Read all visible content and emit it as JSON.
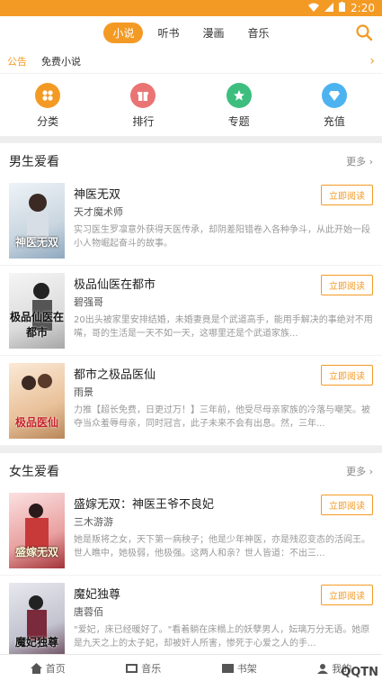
{
  "status": {
    "time": "2:20"
  },
  "tabs": [
    {
      "label": "小说",
      "active": true
    },
    {
      "label": "听书",
      "active": false
    },
    {
      "label": "漫画",
      "active": false
    },
    {
      "label": "音乐",
      "active": false
    }
  ],
  "notice": {
    "tag": "公告",
    "text": "免费小说",
    "arrow": "›"
  },
  "quicknav": [
    {
      "label": "分类",
      "color": "#F39A25",
      "icon": "grid-icon"
    },
    {
      "label": "排行",
      "color": "#EA7474",
      "icon": "gift-icon"
    },
    {
      "label": "专题",
      "color": "#3DBE7E",
      "icon": "star-icon"
    },
    {
      "label": "充值",
      "color": "#4CB3F0",
      "icon": "diamond-icon"
    }
  ],
  "male_section": {
    "title": "男生爱看",
    "more": "更多 ›",
    "books": [
      {
        "title": "神医无双",
        "author": "天才魔术师",
        "desc": "实习医生罗凛意外获得天医传承，却阴差阳错卷入各种争斗，从此开始一段小人物崛起奋斗的故事。",
        "cover_text": "神医无双",
        "read": "立即阅读"
      },
      {
        "title": "极品仙医在都市",
        "author": "碧强哥",
        "desc": "20出头被家里安排结婚，未婚妻竟是个武道高手，能用手解决的事绝对不用嘴，哥的生活是一天不如一天，这哪里还是个武道家族...",
        "cover_text": "极品仙医在都市",
        "read": "立即阅读"
      },
      {
        "title": "都市之极品医仙",
        "author": "雨景",
        "desc": "力推【超长免费，日更过万！】三年前，他受尽母亲家族的冷落与嘲笑。被夺当众羞辱母亲，同时冠言，此子未来不会有出息。然，三年...",
        "cover_text": "极品医仙",
        "read": "立即阅读"
      }
    ]
  },
  "female_section": {
    "title": "女生爱看",
    "more": "更多 ›",
    "books": [
      {
        "title": "盛嫁无双：神医王爷不良妃",
        "author": "三木游游",
        "desc": "她是叛将之女，天下第一病秧子；他是少年神医，亦是残忍变态的活阎王。世人瞧中，她极弱，他极强。这两人和亲？世人皆道：不出三...",
        "cover_text": "盛嫁无双",
        "read": "立即阅读"
      },
      {
        "title": "魔妃独尊",
        "author": "唐蓉佰",
        "desc": "\"爱妃，床已经暖好了。\"看着躺在床榻上的妖孽男人，妘璃万分无语。她原是九天之上的太子妃，却被奸人所害，惨死于心爱之人的手...",
        "cover_text": "魔妃独尊",
        "read": "立即阅读"
      }
    ]
  },
  "bottom_nav": [
    {
      "label": "首页",
      "icon": "home-icon"
    },
    {
      "label": "音乐",
      "icon": "music-icon"
    },
    {
      "label": "书架",
      "icon": "shelf-icon"
    },
    {
      "label": "我的",
      "icon": "user-icon"
    }
  ],
  "watermark": "QQTN"
}
